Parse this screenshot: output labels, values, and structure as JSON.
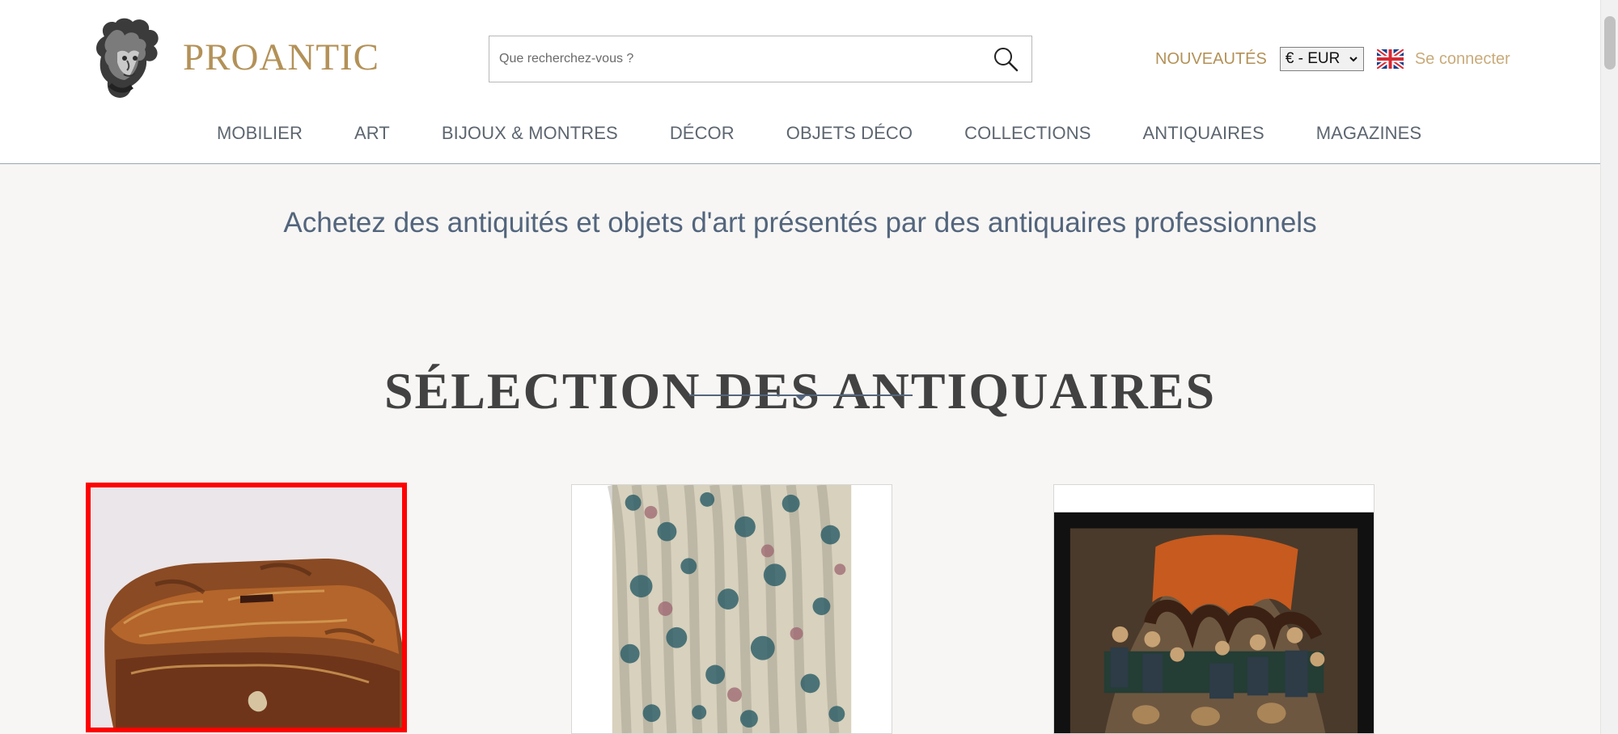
{
  "brand": {
    "name": "PROANTIC",
    "logo_icon": "classical-head-icon",
    "accent_color": "#b39157"
  },
  "search": {
    "placeholder": "Que recherchez-vous ?",
    "value": "",
    "icon": "search-icon"
  },
  "header": {
    "new_label": "NOUVEAUTÉS",
    "currency_selected": "€ - EUR",
    "language_icon": "uk-flag-icon",
    "login_label": "Se connecter"
  },
  "navigation": {
    "items": [
      {
        "label": "MOBILIER"
      },
      {
        "label": "ART"
      },
      {
        "label": "BIJOUX & MONTRES"
      },
      {
        "label": "DÉCOR"
      },
      {
        "label": "OBJETS DÉCO"
      },
      {
        "label": "COLLECTIONS"
      },
      {
        "label": "ANTIQUAIRES"
      },
      {
        "label": "MAGAZINES"
      }
    ]
  },
  "hero": {
    "tagline": "Achetez des antiquités et objets d'art présentés par des antiquaires professionnels"
  },
  "selection": {
    "title": "SÉLECTION DES ANTIQUAIRES",
    "products": [
      {
        "name": "carved-box-image",
        "selected": true
      },
      {
        "name": "floral-curtains-image",
        "selected": false
      },
      {
        "name": "tavern-painting-image",
        "selected": false
      }
    ]
  },
  "colors": {
    "page_background": "#f7f6f4",
    "header_background": "#ffffff",
    "selection_border": "#ff0000",
    "tagline": "#53657d"
  }
}
